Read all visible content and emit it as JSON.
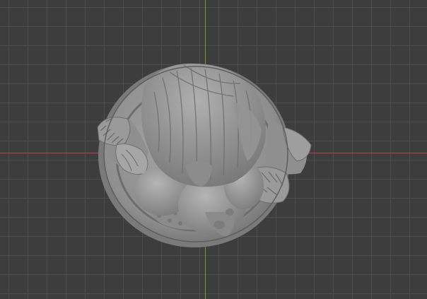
{
  "viewport": {
    "background_color": "#3d3d3d",
    "grid_color": "#505050",
    "x_axis_color": "#c0404f",
    "y_axis_color": "#6d9c24",
    "model_color": "#9e9e9e",
    "model_shade_color": "#6a6a6a",
    "model": "sculpted-figurine-top-view"
  }
}
